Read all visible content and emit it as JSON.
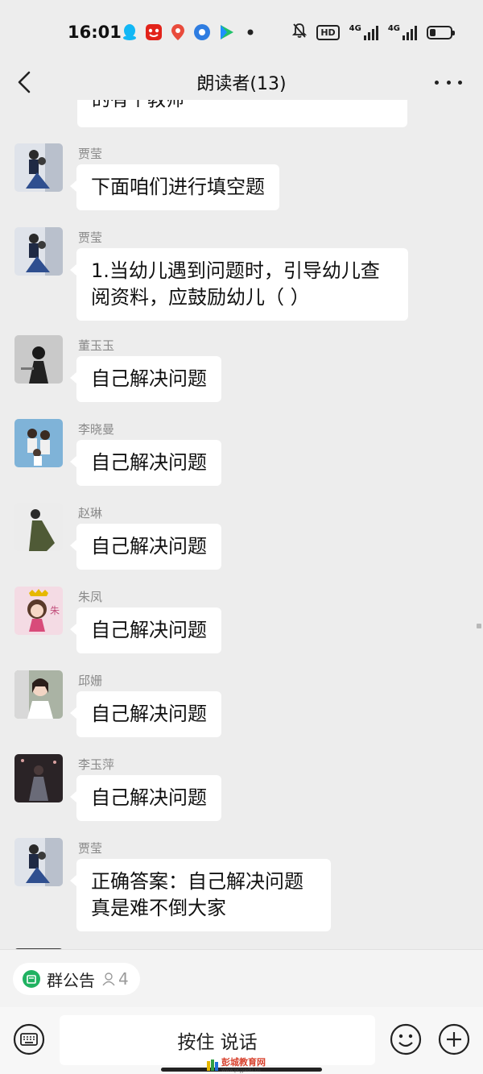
{
  "status_bar": {
    "time": "16:01",
    "app_icons": [
      "qq-icon",
      "netease-icon",
      "map-pin-icon",
      "browser-icon",
      "video-play-icon",
      "dot-icon"
    ],
    "hd_label": "HD",
    "network1": "4G",
    "network2": "4G",
    "battery_level": 0.25
  },
  "header": {
    "title": "朗读者(13)"
  },
  "partial_top_text": "的有个教师",
  "messages": [
    {
      "sender": "贾莹",
      "text": "下面咱们进行填空题"
    },
    {
      "sender": "贾莹",
      "text": "1.当幼儿遇到问题时，引导幼儿查\n阅资料，应鼓励幼儿（  ）"
    },
    {
      "sender": "董玉玉",
      "text": "自己解决问题"
    },
    {
      "sender": "李晓曼",
      "text": "自己解决问题"
    },
    {
      "sender": "赵琳",
      "text": "自己解决问题"
    },
    {
      "sender": "朱凤",
      "text": "自己解决问题"
    },
    {
      "sender": "邱姗",
      "text": "自己解决问题"
    },
    {
      "sender": "李玉萍",
      "text": "自己解决问题"
    },
    {
      "sender": "贾莹",
      "text": "正确答案：自己解决问题\n真是难不倒大家"
    }
  ],
  "notice": {
    "label": "群公告",
    "count": "4"
  },
  "input": {
    "hold_to_talk": "按住 说话"
  },
  "watermark": {
    "text": "彭城教育网",
    "url": "www.pcjyedu.cn"
  },
  "colors": {
    "background": "#ededed",
    "bubble": "#ffffff",
    "accent_green": "#20b261",
    "watermark_red": "#d8432f"
  }
}
